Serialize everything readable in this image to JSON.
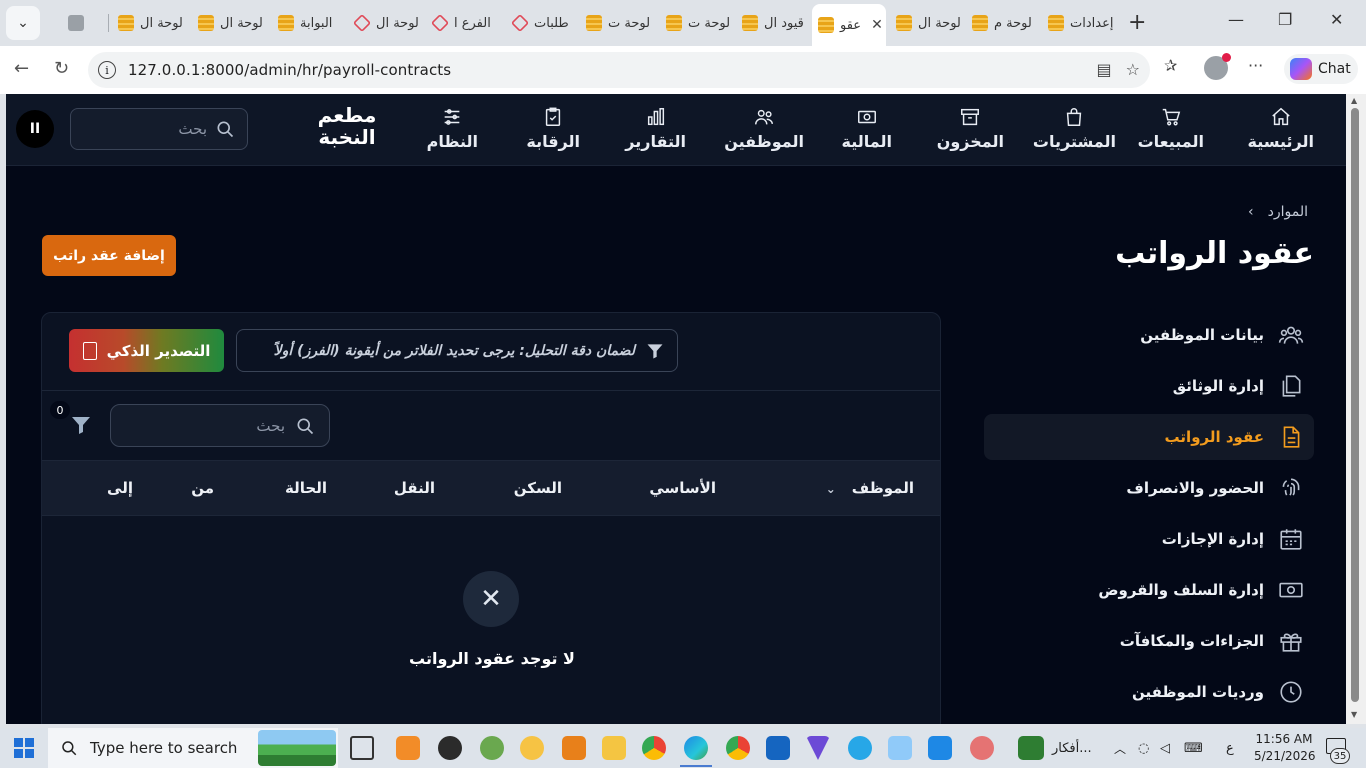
{
  "browser": {
    "tabs": [
      {
        "label": "إعدادات",
        "favicon": "stack-icon"
      },
      {
        "label": "لوحة م",
        "favicon": "stack-icon"
      },
      {
        "label": "لوحة ال",
        "favicon": "stack-icon"
      },
      {
        "label": "عقو",
        "favicon": "stack-icon",
        "active": true
      },
      {
        "label": "قيود ال",
        "favicon": "stack-icon"
      },
      {
        "label": "لوحة ت",
        "favicon": "stack-icon"
      },
      {
        "label": "لوحة ت",
        "favicon": "stack-icon"
      },
      {
        "label": "طلبات",
        "favicon": "laravel-icon"
      },
      {
        "label": "الفرع ا",
        "favicon": "laravel-icon"
      },
      {
        "label": "لوحة ال",
        "favicon": "laravel-icon"
      },
      {
        "label": "البوابة",
        "favicon": "stack-icon"
      },
      {
        "label": "لوحة ال",
        "favicon": "stack-icon"
      },
      {
        "label": "لوحة ال",
        "favicon": "stack-icon"
      }
    ],
    "url": "127.0.0.1:8000/admin/hr/payroll-contracts",
    "chat_label": "Chat"
  },
  "nav": {
    "items": [
      {
        "label": "الرئيسية",
        "icon": "home-icon"
      },
      {
        "label": "المبيعات",
        "icon": "cart-icon"
      },
      {
        "label": "المشتريات",
        "icon": "shopping-bag-icon"
      },
      {
        "label": "المخزون",
        "icon": "archive-box-icon"
      },
      {
        "label": "المالية",
        "icon": "banknote-icon"
      },
      {
        "label": "الموظفين",
        "icon": "users-icon"
      },
      {
        "label": "التقارير",
        "icon": "bar-chart-icon"
      },
      {
        "label": "الرقابة",
        "icon": "clipboard-check-icon"
      },
      {
        "label": "النظام",
        "icon": "sliders-icon"
      }
    ],
    "brand_line1": "مطعم",
    "brand_line2": "النخبة",
    "search_placeholder": "بحث",
    "pause_label": "II"
  },
  "breadcrumb": {
    "parent": "الموارد",
    "separator": "›"
  },
  "page": {
    "title": "عقود الرواتب",
    "add_button": "إضافة عقد راتب"
  },
  "sidebar": {
    "items": [
      {
        "label": "بيانات الموظفين",
        "icon": "users-icon"
      },
      {
        "label": "إدارة الوثائق",
        "icon": "documents-icon"
      },
      {
        "label": "عقود الرواتب",
        "icon": "document-text-icon",
        "active": true
      },
      {
        "label": "الحضور والانصراف",
        "icon": "fingerprint-icon"
      },
      {
        "label": "إدارة الإجازات",
        "icon": "calendar-icon"
      },
      {
        "label": "إدارة السلف والقروض",
        "icon": "banknote-icon"
      },
      {
        "label": "الجزاءات والمكافآت",
        "icon": "gift-icon"
      },
      {
        "label": "ورديات الموظفين",
        "icon": "clock-icon"
      }
    ]
  },
  "table": {
    "hint": "لضمان دقة التحليل: يرجى تحديد الفلاتر من أيقونة (الفرز) أولاً",
    "export_label": "التصدير الذكي",
    "search_placeholder": "بحث",
    "filter_count": "0",
    "columns": [
      "الموظف",
      "الأساسي",
      "السكن",
      "النقل",
      "الحالة",
      "من",
      "إلى"
    ],
    "empty_message": "لا توجد عقود الرواتب"
  },
  "taskbar": {
    "search_placeholder": "Type here to search",
    "tray_app_label": "أفكار...",
    "lang": "ع",
    "time": "11:56 AM",
    "date": "5/21/2026",
    "notifications": "35"
  },
  "colors": {
    "accent": "#f39c1e",
    "add_button": "#d9680f",
    "background": "#030817",
    "topnav": "#0e1626"
  }
}
